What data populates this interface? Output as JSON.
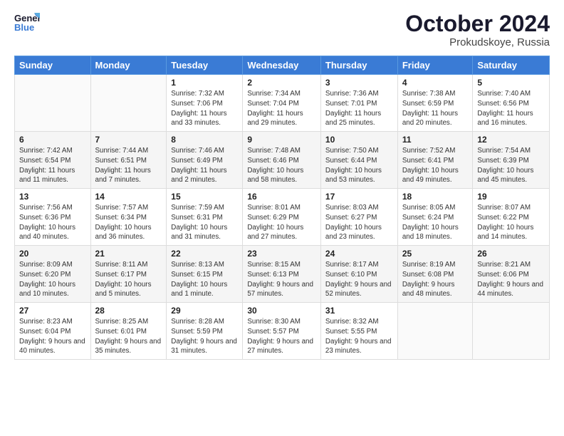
{
  "logo": {
    "line1": "General",
    "line2": "Blue"
  },
  "title": "October 2024",
  "subtitle": "Prokudskoye, Russia",
  "days_header": [
    "Sunday",
    "Monday",
    "Tuesday",
    "Wednesday",
    "Thursday",
    "Friday",
    "Saturday"
  ],
  "weeks": [
    [
      {
        "day": "",
        "info": ""
      },
      {
        "day": "",
        "info": ""
      },
      {
        "day": "1",
        "info": "Sunrise: 7:32 AM\nSunset: 7:06 PM\nDaylight: 11 hours and 33 minutes."
      },
      {
        "day": "2",
        "info": "Sunrise: 7:34 AM\nSunset: 7:04 PM\nDaylight: 11 hours and 29 minutes."
      },
      {
        "day": "3",
        "info": "Sunrise: 7:36 AM\nSunset: 7:01 PM\nDaylight: 11 hours and 25 minutes."
      },
      {
        "day": "4",
        "info": "Sunrise: 7:38 AM\nSunset: 6:59 PM\nDaylight: 11 hours and 20 minutes."
      },
      {
        "day": "5",
        "info": "Sunrise: 7:40 AM\nSunset: 6:56 PM\nDaylight: 11 hours and 16 minutes."
      }
    ],
    [
      {
        "day": "6",
        "info": "Sunrise: 7:42 AM\nSunset: 6:54 PM\nDaylight: 11 hours and 11 minutes."
      },
      {
        "day": "7",
        "info": "Sunrise: 7:44 AM\nSunset: 6:51 PM\nDaylight: 11 hours and 7 minutes."
      },
      {
        "day": "8",
        "info": "Sunrise: 7:46 AM\nSunset: 6:49 PM\nDaylight: 11 hours and 2 minutes."
      },
      {
        "day": "9",
        "info": "Sunrise: 7:48 AM\nSunset: 6:46 PM\nDaylight: 10 hours and 58 minutes."
      },
      {
        "day": "10",
        "info": "Sunrise: 7:50 AM\nSunset: 6:44 PM\nDaylight: 10 hours and 53 minutes."
      },
      {
        "day": "11",
        "info": "Sunrise: 7:52 AM\nSunset: 6:41 PM\nDaylight: 10 hours and 49 minutes."
      },
      {
        "day": "12",
        "info": "Sunrise: 7:54 AM\nSunset: 6:39 PM\nDaylight: 10 hours and 45 minutes."
      }
    ],
    [
      {
        "day": "13",
        "info": "Sunrise: 7:56 AM\nSunset: 6:36 PM\nDaylight: 10 hours and 40 minutes."
      },
      {
        "day": "14",
        "info": "Sunrise: 7:57 AM\nSunset: 6:34 PM\nDaylight: 10 hours and 36 minutes."
      },
      {
        "day": "15",
        "info": "Sunrise: 7:59 AM\nSunset: 6:31 PM\nDaylight: 10 hours and 31 minutes."
      },
      {
        "day": "16",
        "info": "Sunrise: 8:01 AM\nSunset: 6:29 PM\nDaylight: 10 hours and 27 minutes."
      },
      {
        "day": "17",
        "info": "Sunrise: 8:03 AM\nSunset: 6:27 PM\nDaylight: 10 hours and 23 minutes."
      },
      {
        "day": "18",
        "info": "Sunrise: 8:05 AM\nSunset: 6:24 PM\nDaylight: 10 hours and 18 minutes."
      },
      {
        "day": "19",
        "info": "Sunrise: 8:07 AM\nSunset: 6:22 PM\nDaylight: 10 hours and 14 minutes."
      }
    ],
    [
      {
        "day": "20",
        "info": "Sunrise: 8:09 AM\nSunset: 6:20 PM\nDaylight: 10 hours and 10 minutes."
      },
      {
        "day": "21",
        "info": "Sunrise: 8:11 AM\nSunset: 6:17 PM\nDaylight: 10 hours and 5 minutes."
      },
      {
        "day": "22",
        "info": "Sunrise: 8:13 AM\nSunset: 6:15 PM\nDaylight: 10 hours and 1 minute."
      },
      {
        "day": "23",
        "info": "Sunrise: 8:15 AM\nSunset: 6:13 PM\nDaylight: 9 hours and 57 minutes."
      },
      {
        "day": "24",
        "info": "Sunrise: 8:17 AM\nSunset: 6:10 PM\nDaylight: 9 hours and 52 minutes."
      },
      {
        "day": "25",
        "info": "Sunrise: 8:19 AM\nSunset: 6:08 PM\nDaylight: 9 hours and 48 minutes."
      },
      {
        "day": "26",
        "info": "Sunrise: 8:21 AM\nSunset: 6:06 PM\nDaylight: 9 hours and 44 minutes."
      }
    ],
    [
      {
        "day": "27",
        "info": "Sunrise: 8:23 AM\nSunset: 6:04 PM\nDaylight: 9 hours and 40 minutes."
      },
      {
        "day": "28",
        "info": "Sunrise: 8:25 AM\nSunset: 6:01 PM\nDaylight: 9 hours and 35 minutes."
      },
      {
        "day": "29",
        "info": "Sunrise: 8:28 AM\nSunset: 5:59 PM\nDaylight: 9 hours and 31 minutes."
      },
      {
        "day": "30",
        "info": "Sunrise: 8:30 AM\nSunset: 5:57 PM\nDaylight: 9 hours and 27 minutes."
      },
      {
        "day": "31",
        "info": "Sunrise: 8:32 AM\nSunset: 5:55 PM\nDaylight: 9 hours and 23 minutes."
      },
      {
        "day": "",
        "info": ""
      },
      {
        "day": "",
        "info": ""
      }
    ]
  ]
}
